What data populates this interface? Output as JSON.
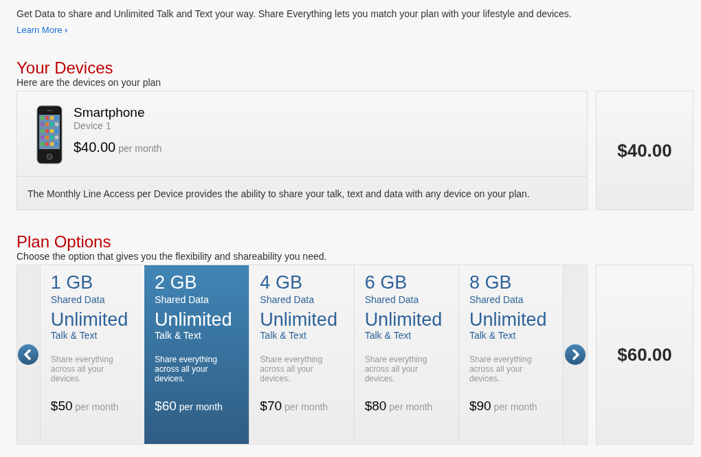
{
  "intro": {
    "text": "Get Data to share and Unlimited Talk and Text your way. Share Everything lets you match your plan with your lifestyle and devices.",
    "link": "Learn More",
    "link_arrow": "›"
  },
  "devices_section": {
    "title": "Your Devices",
    "subtitle": "Here are the devices on your plan"
  },
  "device": {
    "name": "Smartphone",
    "label": "Device 1",
    "price": "$40.00",
    "per": "per month",
    "note": "The Monthly Line Access per Device provides the ability to share your talk, text and data with any device on your plan."
  },
  "devices_total": "$40.00",
  "plans_section": {
    "title": "Plan Options",
    "subtitle": "Choose the option that gives you the flexibility and shareability you need."
  },
  "plans": [
    {
      "size": "1 GB",
      "data_label": "Shared Data",
      "talk": "Unlimited",
      "talk_label": "Talk & Text",
      "desc": "Share everything across all your devices.",
      "price": "$50",
      "per": "per month",
      "selected": false
    },
    {
      "size": "2 GB",
      "data_label": "Shared Data",
      "talk": "Unlimited",
      "talk_label": "Talk & Text",
      "desc": "Share everything across all your devices.",
      "price": "$60",
      "per": "per month",
      "selected": true
    },
    {
      "size": "4 GB",
      "data_label": "Shared Data",
      "talk": "Unlimited",
      "talk_label": "Talk & Text",
      "desc": "Share everything across all your devices.",
      "price": "$70",
      "per": "per month",
      "selected": false
    },
    {
      "size": "6 GB",
      "data_label": "Shared Data",
      "talk": "Unlimited",
      "talk_label": "Talk & Text",
      "desc": "Share everything across all your devices.",
      "price": "$80",
      "per": "per month",
      "selected": false
    },
    {
      "size": "8 GB",
      "data_label": "Shared Data",
      "talk": "Unlimited",
      "talk_label": "Talk & Text",
      "desc": "Share everything across all your devices.",
      "price": "$90",
      "per": "per month",
      "selected": false
    }
  ],
  "plans_total": "$60.00"
}
